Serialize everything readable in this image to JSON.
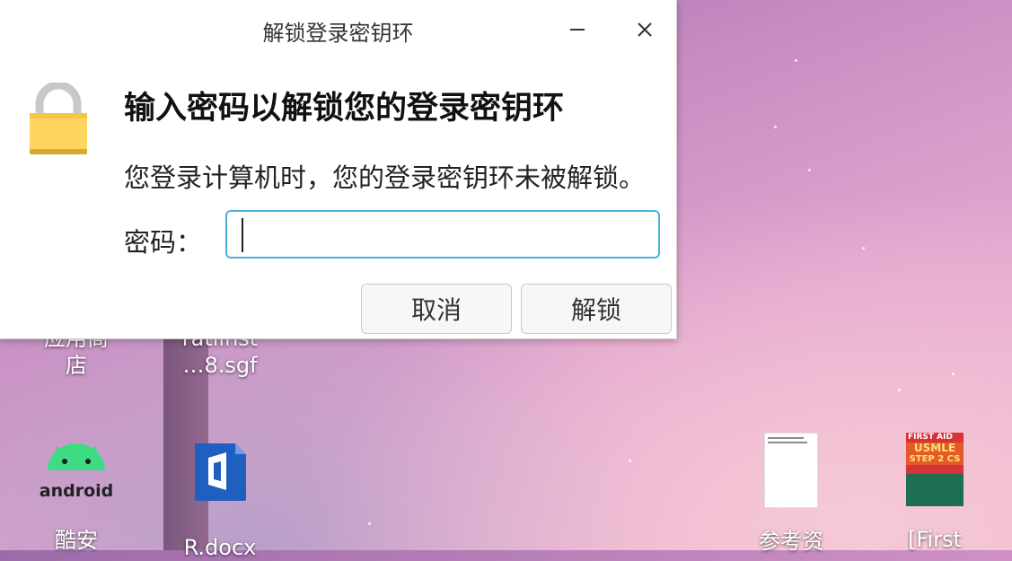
{
  "dialog": {
    "title": "解锁登录密钥环",
    "heading": "输入密码以解锁您的登录密钥环",
    "description": "您登录计算机时，您的登录密钥环未被解锁。",
    "password_label": "密码：",
    "password_value": "",
    "cancel_label": "取消",
    "unlock_label": "解锁",
    "icons": [
      "lock-icon",
      "minimize-icon",
      "close-icon"
    ],
    "accent_color": "#4ab0e0"
  },
  "desktop": {
    "icons": [
      {
        "name": "app-store",
        "label": "应用商店",
        "label_line1": "应用商",
        "label_line2": "店"
      },
      {
        "name": "sgf-file",
        "label_line1": "ratlinst",
        "label_line2": "…8.sgf"
      },
      {
        "name": "android-app",
        "label": "酷安",
        "icon": "android-icon",
        "icon_text": "android"
      },
      {
        "name": "docx-file",
        "label": "R.docx",
        "icon": "office-doc-icon"
      },
      {
        "name": "reference-file",
        "label": "参考资",
        "icon": "document-thumbnail-icon"
      },
      {
        "name": "first-aid-pdf",
        "label": "[First",
        "icon": "book-cover-icon",
        "cover_lines": [
          "FIRST AID",
          "USMLE",
          "STEP 2 CS"
        ]
      }
    ]
  }
}
